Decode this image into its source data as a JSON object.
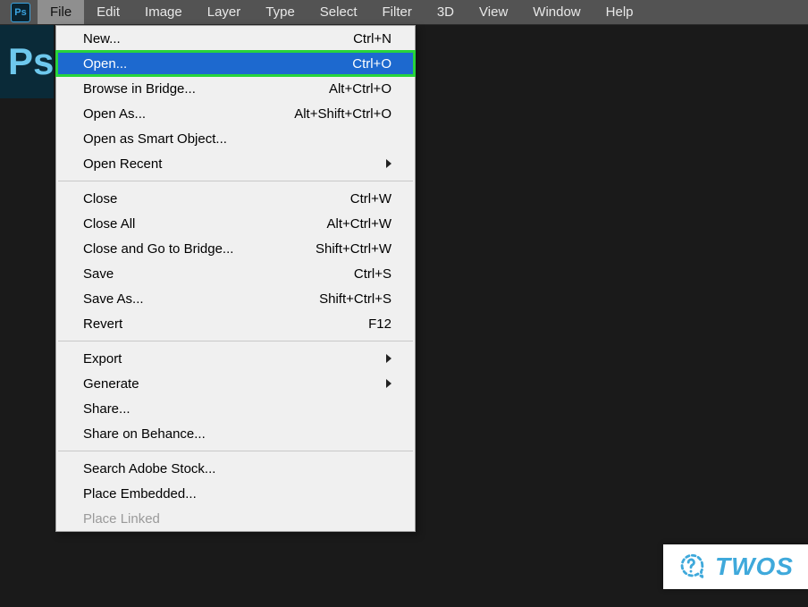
{
  "menubar": {
    "items": [
      "File",
      "Edit",
      "Image",
      "Layer",
      "Type",
      "Select",
      "Filter",
      "3D",
      "View",
      "Window",
      "Help"
    ],
    "active_index": 0,
    "app_abbrev": "Ps"
  },
  "sidebar": {
    "logo_text": "Ps"
  },
  "dropdown": {
    "groups": [
      [
        {
          "label": "New...",
          "shortcut": "Ctrl+N",
          "highlighted": false,
          "submenu": false,
          "disabled": false
        },
        {
          "label": "Open...",
          "shortcut": "Ctrl+O",
          "highlighted": true,
          "submenu": false,
          "disabled": false
        },
        {
          "label": "Browse in Bridge...",
          "shortcut": "Alt+Ctrl+O",
          "highlighted": false,
          "submenu": false,
          "disabled": false
        },
        {
          "label": "Open As...",
          "shortcut": "Alt+Shift+Ctrl+O",
          "highlighted": false,
          "submenu": false,
          "disabled": false
        },
        {
          "label": "Open as Smart Object...",
          "shortcut": "",
          "highlighted": false,
          "submenu": false,
          "disabled": false
        },
        {
          "label": "Open Recent",
          "shortcut": "",
          "highlighted": false,
          "submenu": true,
          "disabled": false
        }
      ],
      [
        {
          "label": "Close",
          "shortcut": "Ctrl+W",
          "highlighted": false,
          "submenu": false,
          "disabled": false
        },
        {
          "label": "Close All",
          "shortcut": "Alt+Ctrl+W",
          "highlighted": false,
          "submenu": false,
          "disabled": false
        },
        {
          "label": "Close and Go to Bridge...",
          "shortcut": "Shift+Ctrl+W",
          "highlighted": false,
          "submenu": false,
          "disabled": false
        },
        {
          "label": "Save",
          "shortcut": "Ctrl+S",
          "highlighted": false,
          "submenu": false,
          "disabled": false
        },
        {
          "label": "Save As...",
          "shortcut": "Shift+Ctrl+S",
          "highlighted": false,
          "submenu": false,
          "disabled": false
        },
        {
          "label": "Revert",
          "shortcut": "F12",
          "highlighted": false,
          "submenu": false,
          "disabled": false
        }
      ],
      [
        {
          "label": "Export",
          "shortcut": "",
          "highlighted": false,
          "submenu": true,
          "disabled": false
        },
        {
          "label": "Generate",
          "shortcut": "",
          "highlighted": false,
          "submenu": true,
          "disabled": false
        },
        {
          "label": "Share...",
          "shortcut": "",
          "highlighted": false,
          "submenu": false,
          "disabled": false
        },
        {
          "label": "Share on Behance...",
          "shortcut": "",
          "highlighted": false,
          "submenu": false,
          "disabled": false
        }
      ],
      [
        {
          "label": "Search Adobe Stock...",
          "shortcut": "",
          "highlighted": false,
          "submenu": false,
          "disabled": false
        },
        {
          "label": "Place Embedded...",
          "shortcut": "",
          "highlighted": false,
          "submenu": false,
          "disabled": false
        },
        {
          "label": "Place Linked",
          "shortcut": "",
          "highlighted": false,
          "submenu": false,
          "disabled": true
        }
      ]
    ]
  },
  "watermark": {
    "text": "TWOS"
  }
}
